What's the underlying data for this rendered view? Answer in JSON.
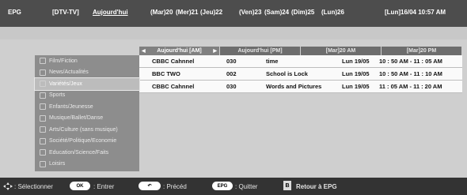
{
  "header": {
    "epg": "EPG",
    "source": "[DTV-TV]",
    "today": "Aujourd'hui",
    "days": [
      "(Mar)20",
      "(Mer)21",
      "(Jeu)22",
      "(Ven)23",
      "(Sam)24",
      "(Dim)25",
      "(Lun)26"
    ],
    "clock": "[Lun]16/04 10:57 AM"
  },
  "tabs": [
    {
      "label": "Aujourd'hui [AM]"
    },
    {
      "label": "Aujourd'hui [PM]"
    },
    {
      "label": "[Mar]20 AM"
    },
    {
      "label": "[Mar]20 PM"
    }
  ],
  "programs": [
    {
      "channel": "CBBC Cahnnel",
      "number": "030",
      "title": "time",
      "date": "Lun 19/05",
      "time": "10 : 50 AM - 11 : 05 AM"
    },
    {
      "channel": "BBC TWO",
      "number": "002",
      "title": "School is Lock",
      "date": "Lun 19/05",
      "time": "10 : 50 AM - 11 : 10 AM"
    },
    {
      "channel": "CBBC Cahnnel",
      "number": "030",
      "title": "Words and Pictures",
      "date": "Lun 19/05",
      "time": "11 : 05 AM - 11 : 20 AM"
    }
  ],
  "genres": [
    {
      "label": "Film/Fiction",
      "icon": "film-icon"
    },
    {
      "label": "News/Actualités",
      "icon": "news-icon"
    },
    {
      "label": "Variétés/Jeux",
      "icon": "show-icon",
      "selected": true
    },
    {
      "label": "Sports",
      "icon": "sports-icon"
    },
    {
      "label": "Enfants/Jeunesse",
      "icon": "children-icon"
    },
    {
      "label": "Musique/Ballet/Danse",
      "icon": "music-icon"
    },
    {
      "label": "Arts/Culture (sans musique)",
      "icon": "arts-icon"
    },
    {
      "label": "Société/Politique/Economie",
      "icon": "society-icon"
    },
    {
      "label": "Education/Science/Faits",
      "icon": "education-icon"
    },
    {
      "label": "Loisirs",
      "icon": "leisure-icon"
    }
  ],
  "help": {
    "select": ": Sélectionner",
    "ok_key": "OK",
    "enter": ": Entrer",
    "back_key": "↶",
    "prev": ": Précéd",
    "epg_key": "EPG",
    "quit": ": Quitter",
    "b_key": "B",
    "back_epg": "Retour à EPG"
  }
}
